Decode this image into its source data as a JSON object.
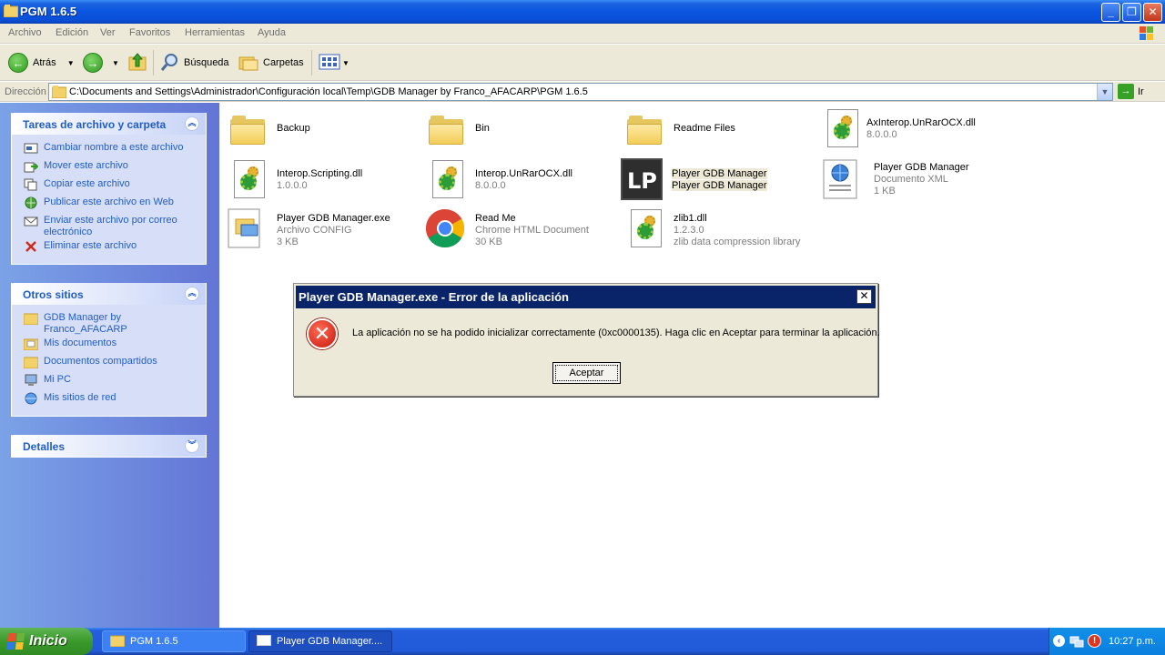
{
  "window": {
    "title": "PGM 1.6.5",
    "minimize": "_",
    "restore": "❐",
    "close": "✕"
  },
  "menu": [
    "Archivo",
    "Edición",
    "Ver",
    "Favoritos",
    "Herramientas",
    "Ayuda"
  ],
  "toolbar": {
    "back_label": "Atrás",
    "search_label": "Búsqueda",
    "folders_label": "Carpetas"
  },
  "address": {
    "label": "Dirección",
    "path": "C:\\Documents and Settings\\Administrador\\Configuración local\\Temp\\GDB Manager by Franco_AFACARP\\PGM 1.6.5",
    "go_label": "Ir"
  },
  "tasks_panel": {
    "title": "Tareas de archivo y carpeta",
    "items": [
      {
        "label": "Cambiar nombre a este archivo",
        "icon": "rename-icon"
      },
      {
        "label": "Mover este archivo",
        "icon": "move-icon"
      },
      {
        "label": "Copiar este archivo",
        "icon": "copy-icon"
      },
      {
        "label": "Publicar este archivo en Web",
        "icon": "publish-icon"
      },
      {
        "label": "Enviar este archivo por correo electrónico",
        "icon": "email-icon"
      },
      {
        "label": "Eliminar este archivo",
        "icon": "delete-icon"
      }
    ]
  },
  "other_places": {
    "title": "Otros sitios",
    "items": [
      {
        "label": "GDB Manager by Franco_AFACARP",
        "icon": "folder-icon"
      },
      {
        "label": "Mis documentos",
        "icon": "documents-icon"
      },
      {
        "label": "Documentos compartidos",
        "icon": "folder-icon"
      },
      {
        "label": "Mi PC",
        "icon": "computer-icon"
      },
      {
        "label": "Mis sitios de red",
        "icon": "network-icon"
      }
    ]
  },
  "details_panel": {
    "title": "Detalles"
  },
  "files": [
    {
      "name": "Backup",
      "line2": "",
      "line3": "",
      "icon": "folder-icon"
    },
    {
      "name": "Bin",
      "line2": "",
      "line3": "",
      "icon": "folder-icon"
    },
    {
      "name": "Readme Files",
      "line2": "",
      "line3": "",
      "icon": "folder-icon"
    },
    {
      "name": "AxInterop.UnRarOCX.dll",
      "line2": "8.0.0.0",
      "line3": "",
      "icon": "dll-icon"
    },
    {
      "name": "Interop.Scripting.dll",
      "line2": "1.0.0.0",
      "line3": "",
      "icon": "dll-icon"
    },
    {
      "name": "Interop.UnRarOCX.dll",
      "line2": "8.0.0.0",
      "line3": "",
      "icon": "dll-icon"
    },
    {
      "name": "Player GDB Manager",
      "line2": "Player GDB Manager",
      "line3": "",
      "icon": "app-icon"
    },
    {
      "name": "Player GDB Manager",
      "line2": "Documento XML",
      "line3": "1 KB",
      "icon": "xml-icon"
    },
    {
      "name": "Player GDB Manager.exe",
      "line2": "Archivo CONFIG",
      "line3": "3 KB",
      "icon": "config-icon"
    },
    {
      "name": "Read Me",
      "line2": "Chrome HTML Document",
      "line3": "30 KB",
      "icon": "chrome-icon"
    },
    {
      "name": "zlib1.dll",
      "line2": "1.2.3.0",
      "line3": "zlib data compression library",
      "icon": "dll-icon"
    }
  ],
  "dialog": {
    "title": "Player GDB Manager.exe - Error de la aplicación",
    "message": "La aplicación no se ha podido inicializar correctamente (0xc0000135). Haga clic en Aceptar para terminar la aplicación.",
    "ok_label": "Aceptar",
    "close": "✕",
    "error_glyph": "✕"
  },
  "taskbar": {
    "start_label": "Inicio",
    "tasks": [
      "PGM 1.6.5",
      "Player GDB Manager...."
    ],
    "clock": "10:27 p.m."
  },
  "colors": {
    "titlebar": "#0a55e0",
    "taskpane_link": "#215dc6",
    "dialog_title": "#0a246a"
  }
}
